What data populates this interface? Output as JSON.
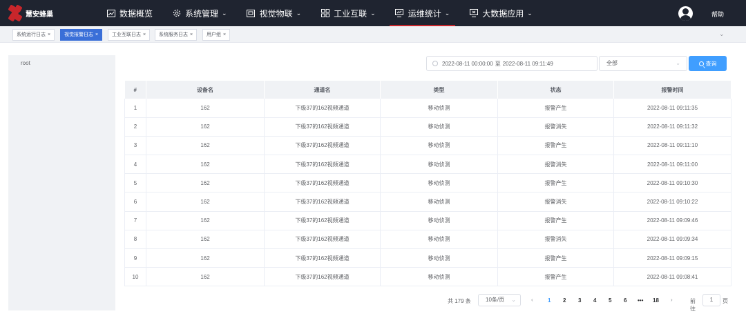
{
  "app": {
    "name": "慧安蜂巢",
    "help": "帮助"
  },
  "nav": [
    {
      "label": "数据概览",
      "icon": "chart-line-icon",
      "chevron": false,
      "active": false
    },
    {
      "label": "系统管理",
      "icon": "gear-icon",
      "chevron": true,
      "active": false
    },
    {
      "label": "视觉物联",
      "icon": "video-card-icon",
      "chevron": true,
      "active": false
    },
    {
      "label": "工业互联",
      "icon": "grid-apps-icon",
      "chevron": true,
      "active": false
    },
    {
      "label": "运维统计",
      "icon": "monitor-stats-icon",
      "chevron": true,
      "active": true
    },
    {
      "label": "大数据应用",
      "icon": "monitor-data-icon",
      "chevron": true,
      "active": false
    }
  ],
  "tabs": [
    {
      "label": "系统运行日志",
      "active": false
    },
    {
      "label": "视觉报警日志",
      "active": true
    },
    {
      "label": "工业互联日志",
      "active": false
    },
    {
      "label": "系统服务日志",
      "active": false
    },
    {
      "label": "用户组",
      "active": false
    }
  ],
  "tree": {
    "root": "root"
  },
  "filters": {
    "start": "2022-08-11 00:00:00",
    "separator": "至",
    "end": "2022-08-11 09:11:49",
    "status_select": "全部",
    "query_label": "查询"
  },
  "table": {
    "columns": [
      "#",
      "设备名",
      "通道名",
      "类型",
      "状态",
      "报警时间"
    ],
    "rows": [
      [
        "1",
        "162",
        "下级37的162视频通道",
        "移动侦测",
        "报警产生",
        "2022-08-11 09:11:35"
      ],
      [
        "2",
        "162",
        "下级37的162视频通道",
        "移动侦测",
        "报警消失",
        "2022-08-11 09:11:32"
      ],
      [
        "3",
        "162",
        "下级37的162视频通道",
        "移动侦测",
        "报警产生",
        "2022-08-11 09:11:10"
      ],
      [
        "4",
        "162",
        "下级37的162视频通道",
        "移动侦测",
        "报警消失",
        "2022-08-11 09:11:00"
      ],
      [
        "5",
        "162",
        "下级37的162视频通道",
        "移动侦测",
        "报警产生",
        "2022-08-11 09:10:30"
      ],
      [
        "6",
        "162",
        "下级37的162视频通道",
        "移动侦测",
        "报警消失",
        "2022-08-11 09:10:22"
      ],
      [
        "7",
        "162",
        "下级37的162视频通道",
        "移动侦测",
        "报警产生",
        "2022-08-11 09:09:46"
      ],
      [
        "8",
        "162",
        "下级37的162视频通道",
        "移动侦测",
        "报警消失",
        "2022-08-11 09:09:34"
      ],
      [
        "9",
        "162",
        "下级37的162视频通道",
        "移动侦测",
        "报警产生",
        "2022-08-11 09:09:15"
      ],
      [
        "10",
        "162",
        "下级37的162视频通道",
        "移动侦测",
        "报警产生",
        "2022-08-11 09:08:41"
      ]
    ]
  },
  "pagination": {
    "total": "共 179 条",
    "page_size": "10条/页",
    "pages": [
      "1",
      "2",
      "3",
      "4",
      "5",
      "6",
      "•••",
      "18"
    ],
    "current": "1",
    "goto_label": "前往",
    "goto_value": "1",
    "page_word": "页"
  },
  "colors": {
    "topbar": "#1f2430",
    "accent_red": "#c8262b",
    "primary_blue": "#409eff",
    "active_tab": "#3a6fd8"
  }
}
